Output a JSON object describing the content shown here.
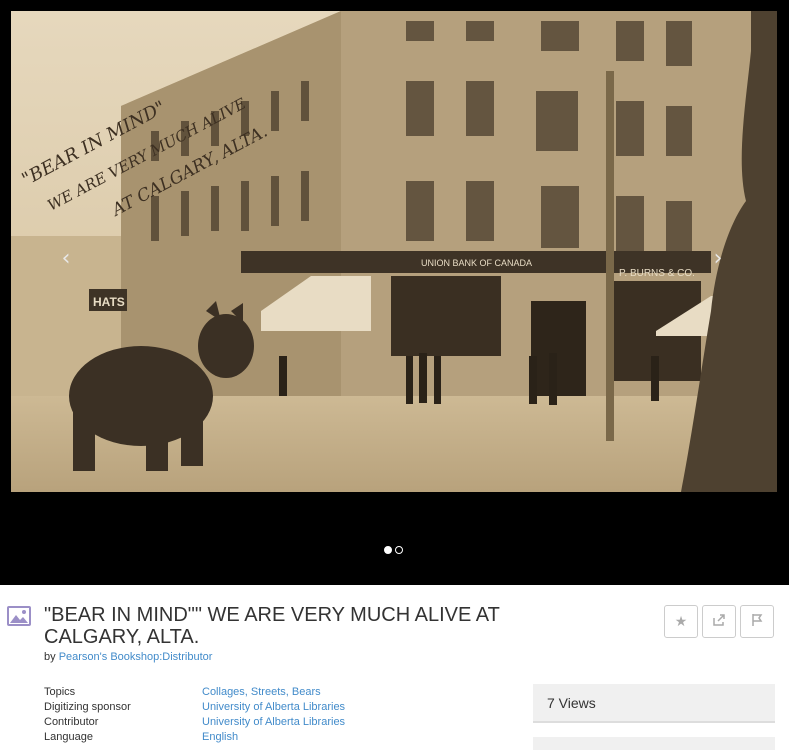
{
  "viewer": {
    "prev_glyph": "‹",
    "next_glyph": "›",
    "slides": 2,
    "active_slide": 1,
    "photo": {
      "overlay_text_1": "\"BEAR IN MIND\"",
      "overlay_text_2": "WE ARE VERY MUCH ALIVE",
      "overlay_text_3": "AT CALGARY, ALTA.",
      "sign_bank": "UNION BANK OF CANADA",
      "sign_burns": "P. BURNS & CO.",
      "sign_hats": "HATS"
    }
  },
  "item": {
    "icon": "image-icon",
    "title": "\"BEAR IN MIND\"\" WE ARE VERY MUCH ALIVE AT CALGARY, ALTA.",
    "by_prefix": "by",
    "creator": "Pearson's Bookshop:Distributor"
  },
  "actions": {
    "favorite_icon": "star-icon",
    "share_icon": "share-icon",
    "flag_icon": "flag-icon"
  },
  "metadata": [
    {
      "key": "Topics",
      "value": "Collages, Streets, Bears"
    },
    {
      "key": "Digitizing sponsor",
      "value": "University of Alberta Libraries"
    },
    {
      "key": "Contributor",
      "value": "University of Alberta Libraries"
    },
    {
      "key": "Language",
      "value": "English"
    }
  ],
  "stats": {
    "views": "7 Views"
  },
  "colors": {
    "link": "#428bca",
    "sepia_light": "#d9c8a8",
    "sepia_dark": "#5a4a35"
  }
}
